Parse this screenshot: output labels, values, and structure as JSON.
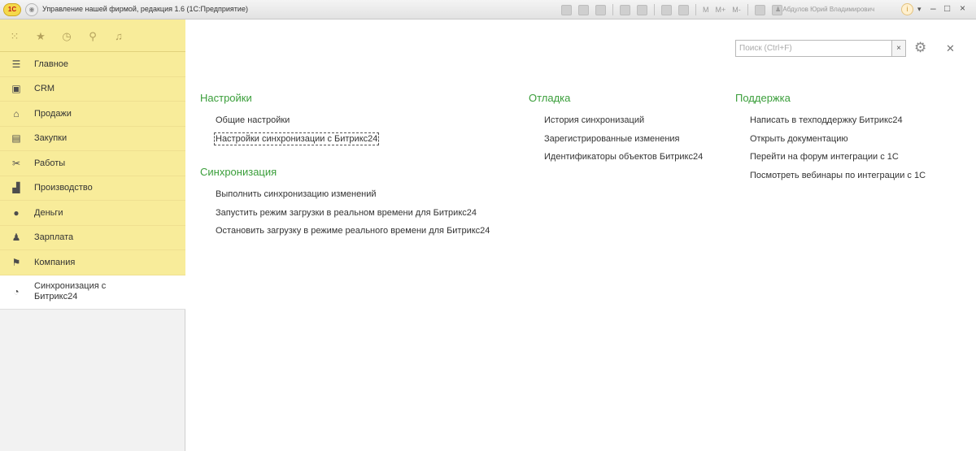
{
  "window": {
    "logo": "1С",
    "title": "Управление нашей фирмой, редакция 1.6  (1С:Предприятие)",
    "toolbar_m": [
      "M",
      "M+",
      "M-"
    ],
    "user": "Абдулов Юрий Владимирович",
    "info": "i",
    "controls": {
      "min": "–",
      "max": "□",
      "close": "×"
    }
  },
  "quickbar": {
    "icons": [
      "apps-icon",
      "star-icon",
      "history-icon",
      "search-icon",
      "bell-icon"
    ]
  },
  "sidebar": {
    "items": [
      {
        "label": "Главное",
        "icon": "menu-lines-icon"
      },
      {
        "label": "CRM",
        "icon": "crm-icon"
      },
      {
        "label": "Продажи",
        "icon": "sales-icon"
      },
      {
        "label": "Закупки",
        "icon": "purchases-icon"
      },
      {
        "label": "Работы",
        "icon": "tools-icon"
      },
      {
        "label": "Производство",
        "icon": "factory-icon"
      },
      {
        "label": "Деньги",
        "icon": "money-icon"
      },
      {
        "label": "Зарплата",
        "icon": "people-icon"
      },
      {
        "label": "Компания",
        "icon": "flag-icon"
      },
      {
        "label": "Синхронизация с Битрикс24",
        "icon": "sync-icon",
        "active": true
      }
    ]
  },
  "search": {
    "placeholder": "Поиск (Ctrl+F)",
    "clear": "×"
  },
  "sections": {
    "settings": {
      "title": "Настройки",
      "links": [
        "Общие настройки",
        "Настройки синхронизации с Битрикс24"
      ]
    },
    "sync": {
      "title": "Синхронизация",
      "links": [
        "Выполнить синхронизацию изменений",
        "Запустить режим загрузки в реальном времени для Битрикс24",
        "Остановить загрузку в режиме реального времени для Битрикс24"
      ]
    },
    "debug": {
      "title": "Отладка",
      "links": [
        "История синхронизаций",
        "Зарегистрированные изменения",
        "Идентификаторы объектов Битрикс24"
      ]
    },
    "support": {
      "title": "Поддержка",
      "links": [
        "Написать в техподдержку Битрикс24",
        "Открыть документацию",
        "Перейти на форум интеграции с 1С",
        "Посмотреть вебинары по интеграции с 1С"
      ]
    }
  },
  "colors": {
    "section_title": "#3a9e3a",
    "sidebar_bg": "#f8ec9a",
    "active_item_bg": "#ffffff"
  }
}
